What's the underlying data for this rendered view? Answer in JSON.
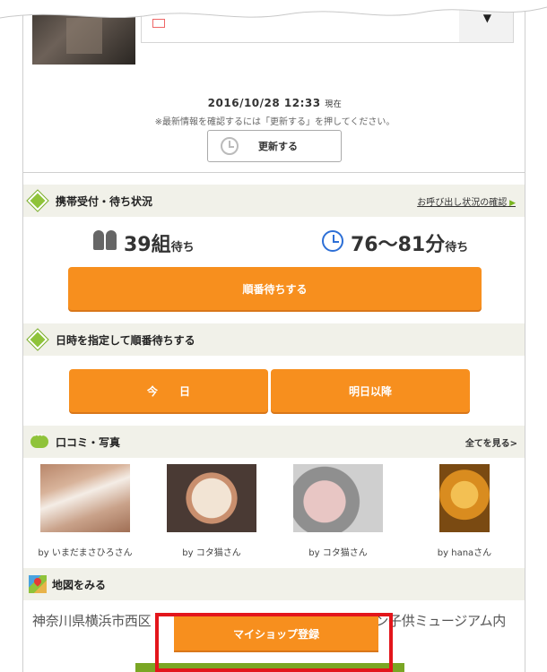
{
  "header": {
    "timestamp": "2016/10/28 12:33",
    "timestamp_suffix": "現在",
    "notice": "※最新情報を確認するには「更新する」を押してください。",
    "refresh_label": "更新する"
  },
  "queue": {
    "section_title": "携帯受付・待ち状況",
    "call_status_link": "お呼び出し状況の確認",
    "groups_value": "39組",
    "groups_suffix": "待ち",
    "wait_value": "76〜81分",
    "wait_suffix": "待ち",
    "join_button": "順番待ちする"
  },
  "schedule": {
    "section_title": "日時を指定して順番待ちする",
    "today_button": "今　　日",
    "tomorrow_button": "明日以降"
  },
  "reviews": {
    "section_title": "口コミ・写真",
    "see_all": "全てを見る>",
    "photos": [
      {
        "caption": "by いまだまさひろさん"
      },
      {
        "caption": "by コタ猫さん"
      },
      {
        "caption": "by コタ猫さん"
      },
      {
        "caption": "by hanaさん"
      }
    ]
  },
  "map": {
    "section_title": "地図をみる",
    "address": "神奈川県横浜市西区　　　　　　　　　　　　アンパンマン子供ミュージアム内"
  },
  "footer": {
    "myshop_button": "マイショップ登録"
  },
  "colors": {
    "accent_orange": "#f78f1e",
    "section_bg": "#f1f1e9",
    "icon_green": "#8fc33a",
    "clock_blue": "#2d6fd6",
    "highlight_red": "#e3151b"
  }
}
